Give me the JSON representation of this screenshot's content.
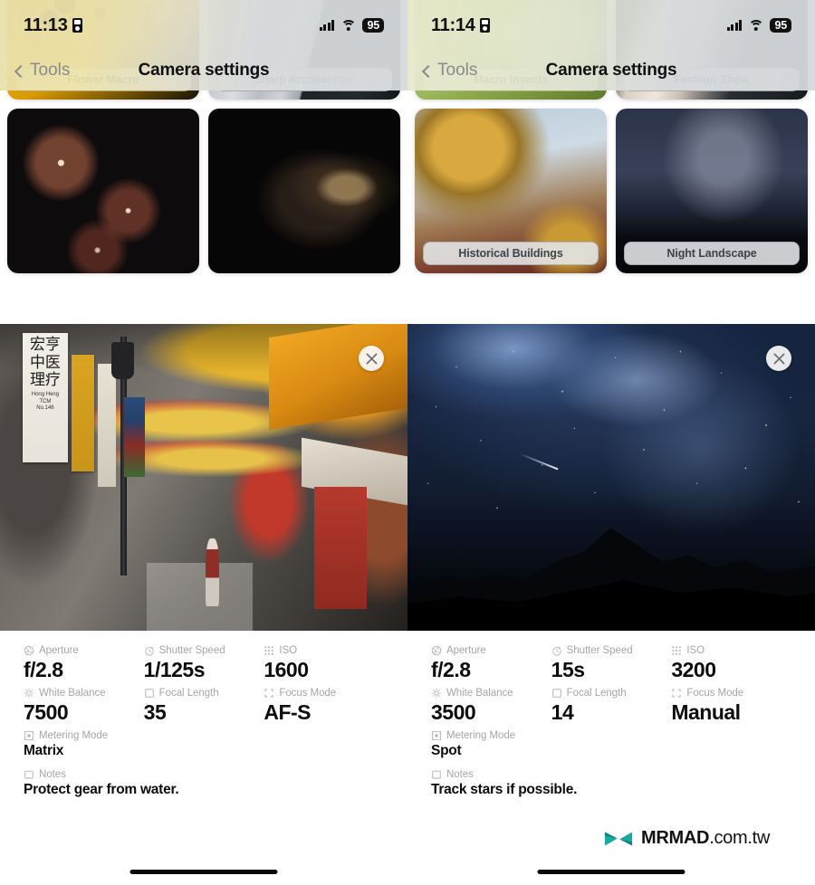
{
  "panels": [
    {
      "status": {
        "time": "11:13",
        "battery": "95",
        "recording_icon": "recording-indicator-icon",
        "signal_icon": "cellular-signal-icon",
        "wifi_icon": "wifi-icon"
      },
      "nav": {
        "back_label": "Tools",
        "title": "Camera settings",
        "back_icon": "chevron-left-icon"
      },
      "grid": [
        {
          "caption": "Flower Macro",
          "art": "ph-flower",
          "cap_bg": "rgba(236,222,160,0.86)",
          "cap_color": "#4a4323",
          "cap_border": "rgba(140,125,60,0.55)"
        },
        {
          "caption": "Sharp Architecture",
          "art": "ph-arch",
          "cap_bg": "rgba(216,220,223,0.88)",
          "cap_color": "#44484c",
          "cap_border": "rgba(120,128,134,0.5)"
        },
        {
          "caption": "",
          "art": "ph-firework",
          "cap_bg": "",
          "cap_color": "",
          "cap_border": ""
        },
        {
          "caption": "",
          "art": "ph-portrait",
          "cap_bg": "",
          "cap_color": "",
          "cap_border": ""
        }
      ],
      "expanded": {
        "name": "chinatown-street-photo",
        "close_label": "close-icon",
        "sign_glyphs": "宏亨\n中医\n理疗",
        "sign_sub": "Hong Heng\nTCM\nNo.146"
      },
      "meta": [
        {
          "label": "Aperture",
          "icon": "aperture-icon",
          "value": "f/2.8"
        },
        {
          "label": "Shutter Speed",
          "icon": "stopwatch-icon",
          "value": "1/125s"
        },
        {
          "label": "ISO",
          "icon": "grid-dots-icon",
          "value": "1600"
        },
        {
          "label": "White Balance",
          "icon": "sun-icon",
          "value": "7500"
        },
        {
          "label": "Focal Length",
          "icon": "square-icon",
          "value": "35"
        },
        {
          "label": "Focus Mode",
          "icon": "focus-brackets-icon",
          "value": "AF-S"
        },
        {
          "label": "Metering Mode",
          "icon": "metering-icon",
          "value": "Matrix"
        },
        {
          "label": "Notes",
          "icon": "note-icon",
          "value": "Protect gear from water."
        }
      ]
    },
    {
      "status": {
        "time": "11:14",
        "battery": "95",
        "recording_icon": "recording-indicator-icon",
        "signal_icon": "cellular-signal-icon",
        "wifi_icon": "wifi-icon"
      },
      "nav": {
        "back_label": "Tools",
        "title": "Camera settings",
        "back_icon": "chevron-left-icon"
      },
      "grid": [
        {
          "caption": "Macro Insects",
          "art": "ph-insects",
          "cap_bg": "rgba(214,223,178,0.86)",
          "cap_color": "#46502c",
          "cap_border": "rgba(120,140,70,0.5)"
        },
        {
          "caption": "Fashion Show",
          "art": "ph-fashion",
          "cap_bg": "rgba(217,221,224,0.85)",
          "cap_color": "#43474b",
          "cap_border": "rgba(120,128,134,0.5)"
        },
        {
          "caption": "Historical Buildings",
          "art": "ph-dome",
          "cap_bg": "rgba(226,228,230,0.9)",
          "cap_color": "#3f4347",
          "cap_border": "rgba(130,138,144,0.5)"
        },
        {
          "caption": "Night Landscape",
          "art": "ph-nightland",
          "cap_bg": "rgba(224,226,229,0.9)",
          "cap_color": "#3f4347",
          "cap_border": "rgba(130,138,144,0.5)"
        }
      ],
      "expanded": {
        "name": "milky-way-night-sky-photo",
        "close_label": "close-icon"
      },
      "meta": [
        {
          "label": "Aperture",
          "icon": "aperture-icon",
          "value": "f/2.8"
        },
        {
          "label": "Shutter Speed",
          "icon": "stopwatch-icon",
          "value": "15s"
        },
        {
          "label": "ISO",
          "icon": "grid-dots-icon",
          "value": "3200"
        },
        {
          "label": "White Balance",
          "icon": "sun-icon",
          "value": "3500"
        },
        {
          "label": "Focal Length",
          "icon": "square-icon",
          "value": "14"
        },
        {
          "label": "Focus Mode",
          "icon": "focus-brackets-icon",
          "value": "Manual"
        },
        {
          "label": "Metering Mode",
          "icon": "metering-icon",
          "value": "Spot"
        },
        {
          "label": "Notes",
          "icon": "note-icon",
          "value": "Track stars if possible."
        }
      ]
    }
  ],
  "watermark": {
    "brand": "MRMAD",
    "tld": ".com.tw",
    "logo_icon": "mrmad-bowtie-logo-icon",
    "color": "#18A9A0"
  }
}
